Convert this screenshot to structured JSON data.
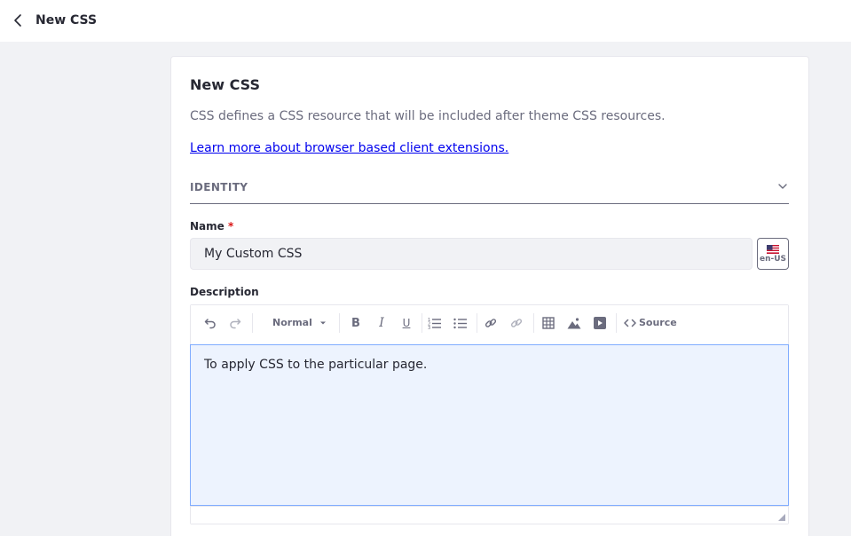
{
  "header": {
    "title": "New CSS",
    "back_icon": "chevron-left-icon"
  },
  "form": {
    "title": "New CSS",
    "description": "CSS defines a CSS resource that will be included after theme CSS resources.",
    "learn_more_link": "Learn more about browser based client extensions.",
    "section": {
      "label": "IDENTITY",
      "expanded": true,
      "toggle_icon": "chevron-down-icon"
    },
    "name": {
      "label": "Name",
      "required_mark": "*",
      "value": "My Custom CSS",
      "locale": "en-US",
      "locale_icon": "us-flag-icon"
    },
    "description_field": {
      "label": "Description",
      "toolbar": {
        "undo_icon": "undo-icon",
        "redo_icon": "redo-icon",
        "format_value": "Normal",
        "bold_icon": "bold-icon",
        "italic_icon": "italic-icon",
        "underline_icon": "underline-icon",
        "ordered_list_icon": "ordered-list-icon",
        "unordered_list_icon": "unordered-list-icon",
        "link_icon": "link-icon",
        "unlink_icon": "unlink-icon",
        "table_icon": "table-icon",
        "image_icon": "image-icon",
        "video_icon": "video-icon",
        "source_label": "Source"
      },
      "content": "To apply CSS to the particular page."
    }
  },
  "colors": {
    "accent": "#0b5fff",
    "link": "#0000ee",
    "required": "#da1414",
    "editor_focus_bg": "#edf3fe",
    "editor_focus_border": "#80acff"
  }
}
